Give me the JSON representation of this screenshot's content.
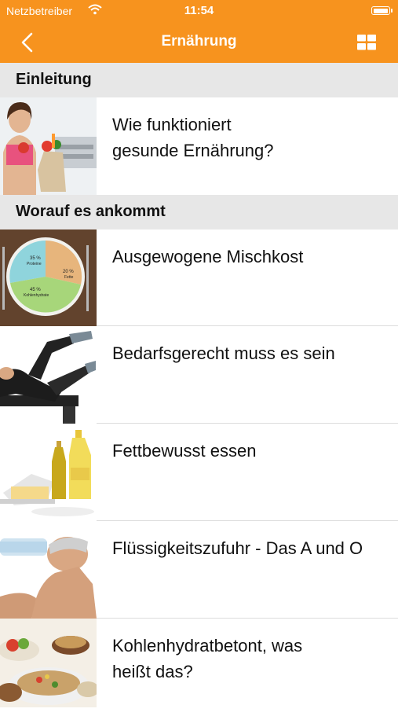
{
  "status_bar": {
    "carrier": "Netzbetreiber",
    "time": "11:54"
  },
  "nav": {
    "title": "Ernährung",
    "back_icon": "chevron-left-icon",
    "grid_icon": "grid-icon",
    "accent": "#f7931e"
  },
  "sections": [
    {
      "title": "Einleitung",
      "items": [
        {
          "label": "Wie funktioniert\ngesunde Ernährung?",
          "image": "woman-with-groceries"
        }
      ]
    },
    {
      "title": "Worauf es ankommt",
      "items": [
        {
          "label": "Ausgewogene Mischkost",
          "image": "pie-plate"
        },
        {
          "label": "Bedarfsgerecht muss es sein",
          "image": "workout"
        },
        {
          "label": "Fettbewusst essen",
          "image": "oil-bottles"
        },
        {
          "label": "Flüssigkeitszufuhr - Das A und O",
          "image": "man-drinking"
        },
        {
          "label": "Kohlenhydratbetont, was\nheißt das?",
          "image": "food-bowls"
        }
      ]
    }
  ],
  "pie_labels": {
    "protein": "35 %",
    "protein_name": "Proteine",
    "fat": "20 %",
    "fat_name": "Fette",
    "carb": "45 %",
    "carb_name": "Kohlenhydrate"
  }
}
